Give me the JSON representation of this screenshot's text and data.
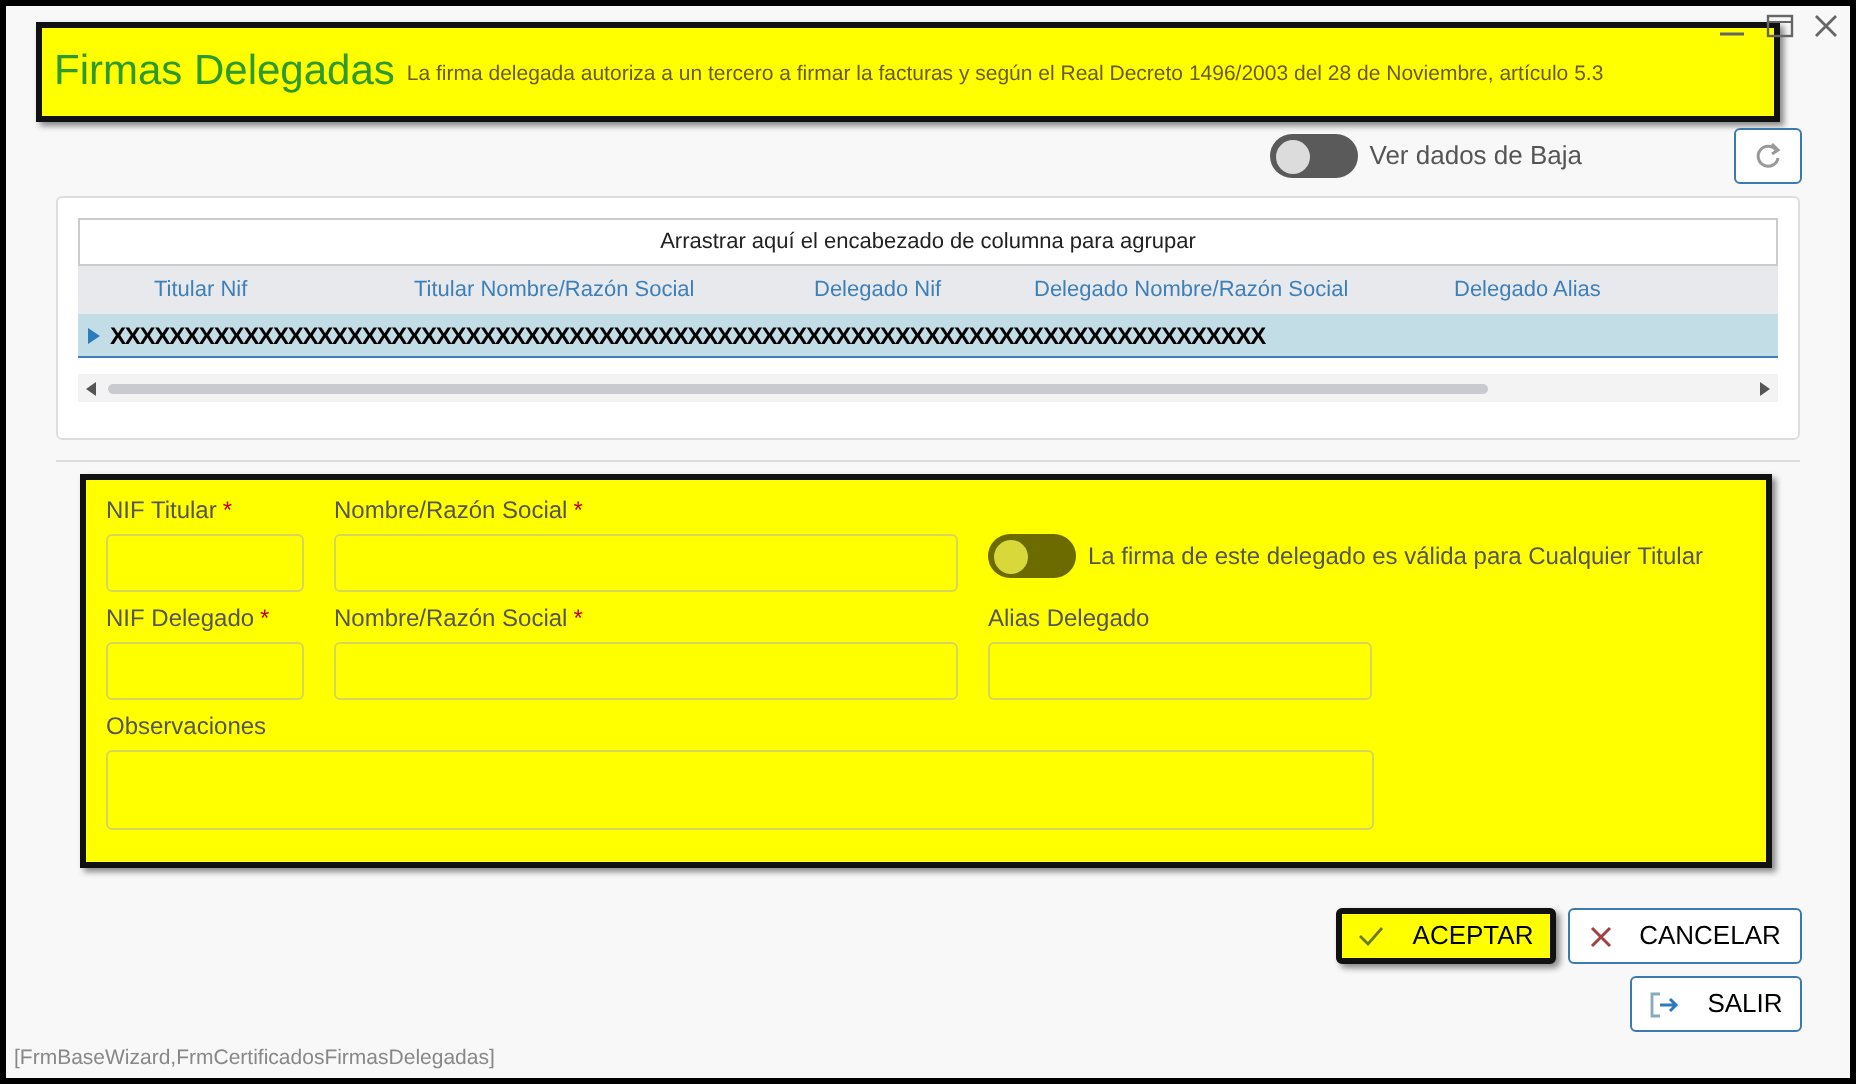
{
  "header": {
    "title": "Firmas Delegadas",
    "subtitle": "La firma delegada autoriza a un tercero a firmar la facturas y según el Real Decreto 1496/2003 del 28 de Noviembre, artículo 5.3"
  },
  "baja_toggle": {
    "label": "Ver dados de Baja",
    "on": false
  },
  "grid": {
    "group_hint": "Arrastrar aquí el encabezado de columna para agrupar",
    "columns": [
      "Titular Nif",
      "Titular Nombre/Razón Social",
      "Delegado Nif",
      "Delegado Nombre/Razón Social",
      "Delegado Alias"
    ],
    "rows": [
      {
        "text": "XXXXXXXXXXXXXXXXXXXXXXXXXXXXXXXXXXXXXXXXXXXXXXXXXXXXXXXXXXXXXXXXXXXXXXXXXXXXXX",
        "selected": true
      }
    ]
  },
  "form": {
    "rows": [
      [
        {
          "label": "NIF Titular",
          "required": true,
          "kind": "short"
        },
        {
          "label": "Nombre/Razón Social",
          "required": true,
          "kind": "long"
        },
        {
          "kind": "toggle",
          "label": "La firma de este delegado es válida para Cualquier Titular",
          "on": false
        }
      ],
      [
        {
          "label": "NIF Delegado",
          "required": true,
          "kind": "short"
        },
        {
          "label": "Nombre/Razón Social",
          "required": true,
          "kind": "long"
        },
        {
          "label": "Alias Delegado",
          "required": false,
          "kind": "medium"
        }
      ],
      [
        {
          "label": "Observaciones",
          "required": false,
          "kind": "multiline"
        }
      ]
    ],
    "required_mark": "*"
  },
  "buttons": [
    {
      "label": "ACEPTAR",
      "kind": "accept"
    },
    {
      "label": "CANCELAR",
      "kind": "cancel"
    },
    {
      "label": "SALIR",
      "kind": "exit"
    }
  ],
  "footer": "[FrmBaseWizard,FrmCertificadosFirmasDelegadas]"
}
